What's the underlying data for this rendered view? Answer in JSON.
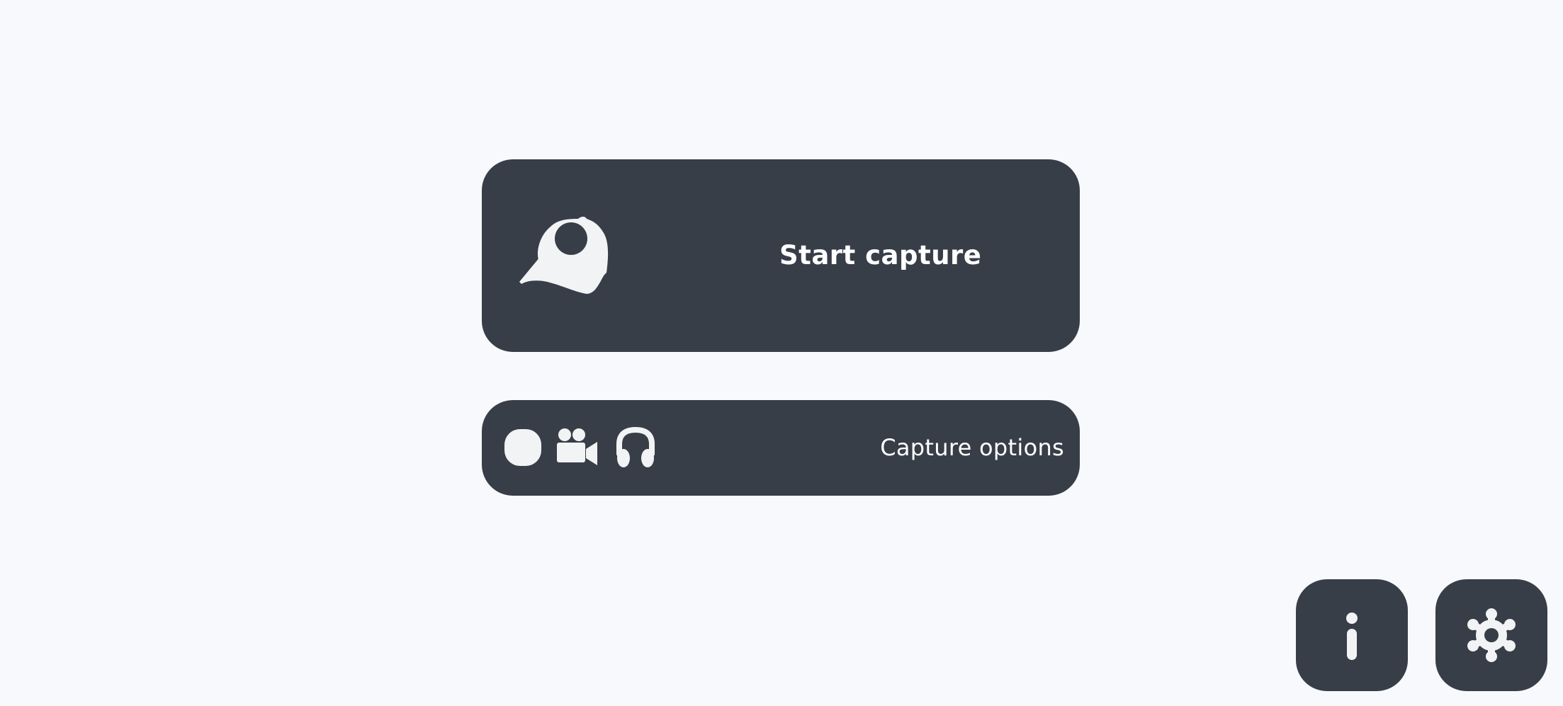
{
  "start_capture": {
    "label": "Start capture",
    "icon": "capture-app-icon"
  },
  "capture_options": {
    "label": "Capture options",
    "icons": [
      "record-icon",
      "video-camera-icon",
      "headphones-icon"
    ]
  },
  "corner_buttons": {
    "info_icon": "info-icon",
    "settings_icon": "gear-icon"
  },
  "colors": {
    "background": "#f7f9fd",
    "card": "#383e48",
    "icon": "#f2f3f4",
    "text": "#ffffff"
  }
}
